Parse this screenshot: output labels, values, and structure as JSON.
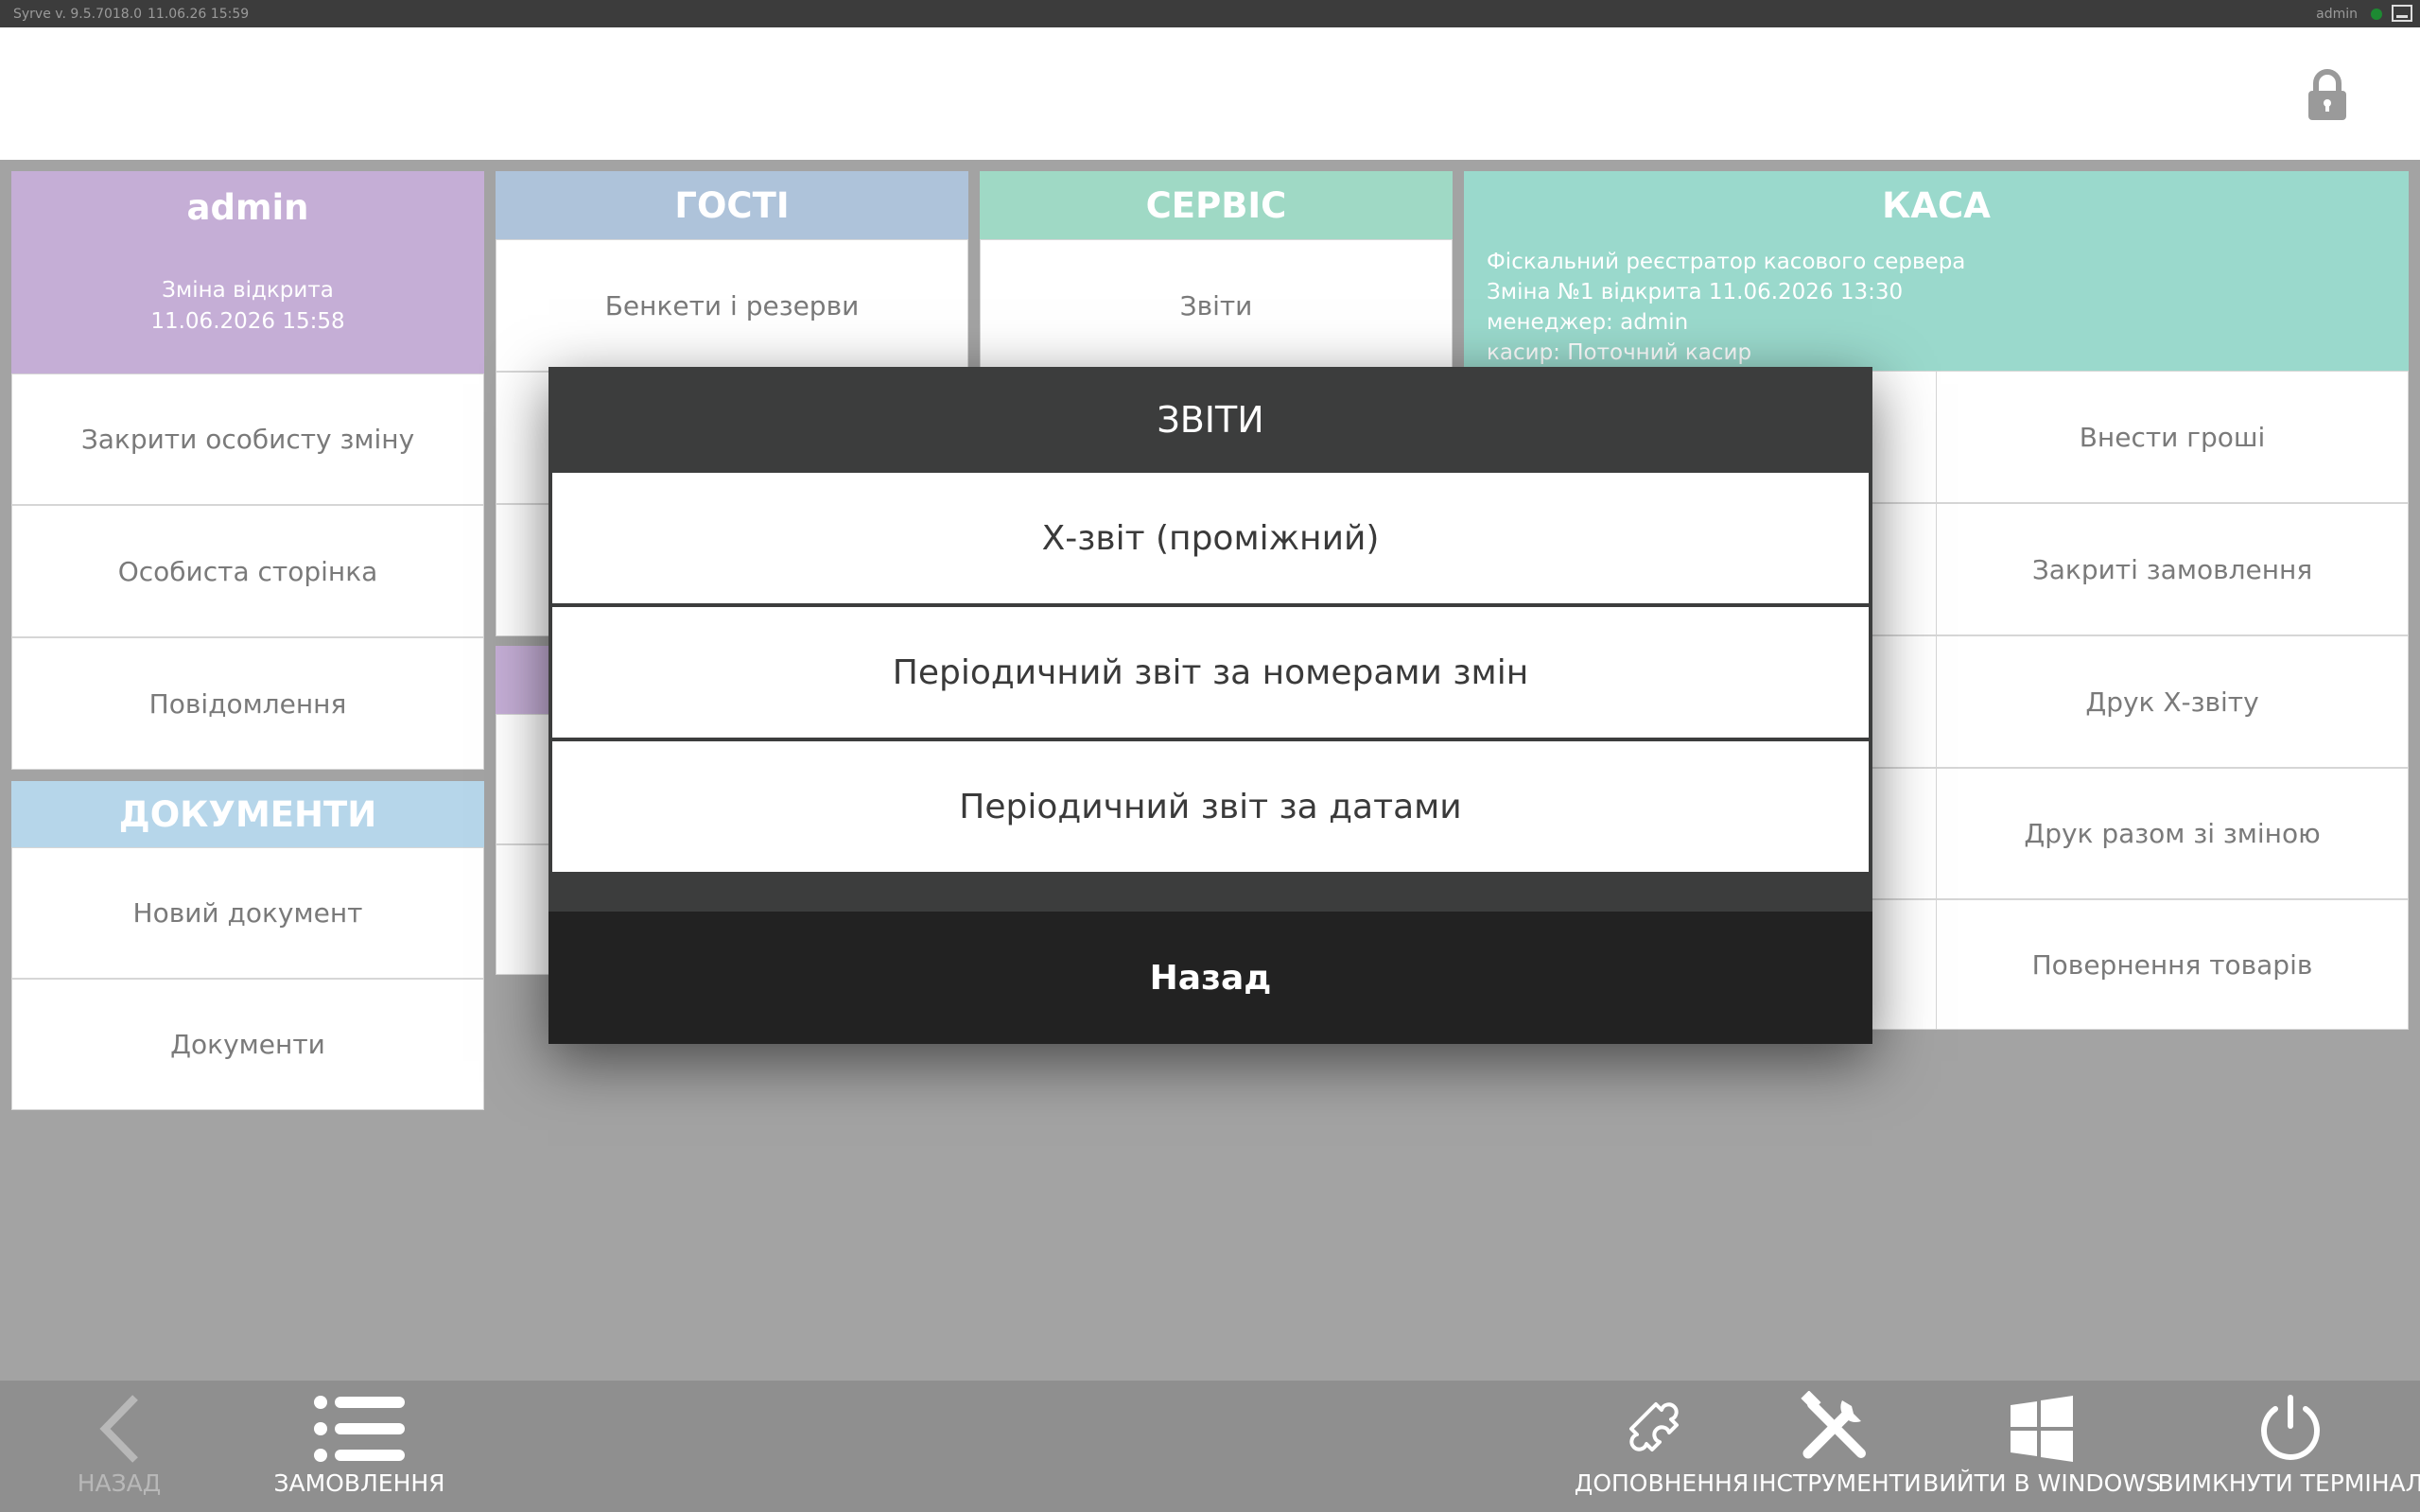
{
  "statusbar": {
    "version": "Syrve  v. 9.5.7018.0",
    "datetime": "11.06.26   15:59",
    "user": "admin"
  },
  "user_panel": {
    "title": "admin",
    "status_line1": "Зміна відкрита",
    "status_line2": "11.06.2026 15:58",
    "items": [
      "Закрити особисту зміну",
      "Особиста сторінка",
      "Повідомлення"
    ]
  },
  "documents_panel": {
    "title": "ДОКУМЕНТИ",
    "items": [
      "Новий документ",
      "Документи"
    ]
  },
  "guests_panel": {
    "title": "ГОСТІ",
    "items": [
      "Бенкети і резерви"
    ]
  },
  "service_panel": {
    "title": "СЕРВІС",
    "items": [
      "Звіти"
    ]
  },
  "kasa_panel": {
    "title": "КАСА",
    "info": [
      "Фіскальний реєстратор касового сервера",
      "Зміна №1 відкрита 11.06.2026 13:30",
      "менеджер: admin",
      "касир: Поточний касир"
    ],
    "items": [
      "Внести гроші",
      "Закриті замовлення",
      "Друк Х-звіту",
      "Друк разом зі зміною",
      "Повернення товарів"
    ]
  },
  "modal": {
    "title": "ЗВІТИ",
    "items": [
      "Х-звіт (проміжний)",
      "Періодичний звіт за номерами змін",
      "Періодичний звіт за датами"
    ],
    "back_label": "Назад"
  },
  "bottombar": {
    "back": "НАЗАД",
    "orders": "ЗАМОВЛЕННЯ",
    "addons": "ДОПОВНЕННЯ",
    "tools": "ІНСТРУМЕНТИ",
    "exit_windows": "ВИЙТИ В WINDOWS",
    "shutdown": "ВИМКНУТИ ТЕРМІНАЛ"
  },
  "colors": {
    "user_panel": "#c5aed6",
    "guests": "#aec3da",
    "service": "#9fd9c5",
    "kasa": "#9ad9cc",
    "documents": "#b6d6ea",
    "modal_bg": "#3c3d3d",
    "back_button": "#222222"
  }
}
